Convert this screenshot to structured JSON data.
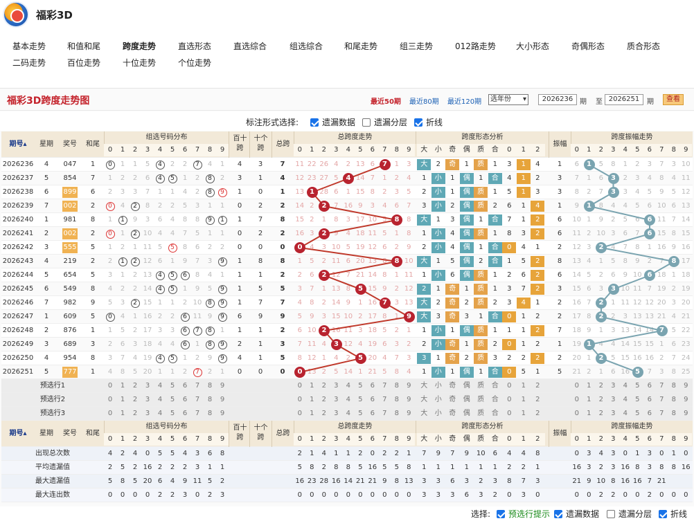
{
  "site": {
    "title": "福彩3D"
  },
  "nav": [
    "基本走势",
    "和值和尾",
    "跨度走势",
    "直选形态",
    "直选综合",
    "组选综合",
    "和尾走势",
    "组三走势",
    "012路走势",
    "大小形态",
    "奇偶形态",
    "质合形态",
    "二码走势",
    "百位走势",
    "十位走势",
    "个位走势"
  ],
  "nav_active": "跨度走势",
  "panel": {
    "title": "福彩3D跨度走势图",
    "links": [
      "最近50期",
      "最近80期",
      "最近120期"
    ],
    "active_link": "最近50期",
    "year_select": "选年份",
    "from": "2026236",
    "to": "2026251",
    "period": "期",
    "to_label": "至",
    "view": "查看"
  },
  "options": {
    "label": "标注形式选择:",
    "items": [
      {
        "label": "遗漏数据",
        "checked": true
      },
      {
        "label": "遗漏分层",
        "checked": false
      },
      {
        "label": "折线",
        "checked": true
      }
    ]
  },
  "headers": {
    "issue": "期号",
    "week": "星期",
    "number": "奖号",
    "tail": "和尾",
    "group_dist": "组选号码分布",
    "bt": "百十跨",
    "sg": "十个跨",
    "bg": "总跨",
    "span_trend": "总跨度走势",
    "shape": "跨度形态分析",
    "shape_cols": [
      "大",
      "小",
      "奇",
      "偶",
      "质",
      "合",
      "0",
      "1",
      "2"
    ],
    "amp": "振幅",
    "amp_trend": "跨度振幅走势",
    "digits": [
      "0",
      "1",
      "2",
      "3",
      "4",
      "5",
      "6",
      "7",
      "8",
      "9"
    ],
    "bt_short": "百十",
    "bt_short2": "跨",
    "sg_short": "十个",
    "sg_short2": "跨",
    "bg_short": "总跨"
  },
  "rows": [
    {
      "issue": "2026236",
      "week": "4",
      "num": "047",
      "tail": "1",
      "bt": "4",
      "sg": "3",
      "span": 7,
      "amp": "1",
      "dist": [
        "0",
        "1",
        "1",
        "5",
        "4",
        "2",
        "2",
        "7",
        "4",
        "1"
      ],
      "circ": [
        0,
        4,
        7
      ],
      "spanrow": [
        "11",
        "22",
        "26",
        "4",
        "2",
        "13",
        "6",
        "7",
        "1",
        "3"
      ],
      "shape": [
        "大",
        "2",
        "奇",
        "1",
        "质",
        "1",
        "3",
        "1",
        "4"
      ],
      "shapeOn": [
        0,
        2,
        4,
        7
      ],
      "amprow": [
        "6",
        "1",
        "5",
        "8",
        "1",
        "2",
        "3",
        "7",
        "3",
        "10"
      ],
      "ampval": 1
    },
    {
      "issue": "2026237",
      "week": "5",
      "num": "854",
      "tail": "7",
      "bt": "3",
      "sg": "1",
      "span": 4,
      "amp": "3",
      "dist": [
        "1",
        "2",
        "2",
        "6",
        "4",
        "5",
        "1",
        "2",
        "8",
        "2"
      ],
      "circ": [
        4,
        5,
        8
      ],
      "spanrow": [
        "12",
        "23",
        "27",
        "5",
        "4",
        "14",
        "7",
        "1",
        "2",
        "4"
      ],
      "shape": [
        "1",
        "小",
        "1",
        "偶",
        "1",
        "合",
        "4",
        "1",
        "2"
      ],
      "shapeOn": [
        1,
        3,
        5,
        7
      ],
      "amprow": [
        "7",
        "1",
        "6",
        "3",
        "2",
        "3",
        "4",
        "8",
        "4",
        "11"
      ],
      "ampval": 3
    },
    {
      "issue": "2026238",
      "week": "6",
      "num": "899",
      "tail": "6",
      "bt": "1",
      "sg": "0",
      "span": 1,
      "amp": "3",
      "dist": [
        "2",
        "3",
        "3",
        "7",
        "1",
        "1",
        "4",
        "2",
        "8",
        "9"
      ],
      "circ": [
        8,
        9
      ],
      "red": [
        9
      ],
      "spanrow": [
        "13",
        "1",
        "28",
        "6",
        "1",
        "15",
        "8",
        "2",
        "3",
        "5"
      ],
      "shape": [
        "2",
        "小",
        "1",
        "偶",
        "质",
        "1",
        "5",
        "1",
        "3"
      ],
      "shapeOn": [
        1,
        3,
        4,
        7
      ],
      "amprow": [
        "8",
        "2",
        "7",
        "3",
        "3",
        "4",
        "5",
        "9",
        "5",
        "12"
      ],
      "ampval": 3
    },
    {
      "issue": "2026239",
      "week": "7",
      "num": "002",
      "tail": "2",
      "bt": "0",
      "sg": "2",
      "span": 2,
      "amp": "1",
      "dist": [
        "0",
        "4",
        "2",
        "8",
        "2",
        "2",
        "5",
        "3",
        "1",
        "1"
      ],
      "circ": [
        0,
        2
      ],
      "red": [
        0
      ],
      "spanrow": [
        "14",
        "2",
        "2",
        "7",
        "16",
        "9",
        "3",
        "4",
        "6",
        "7"
      ],
      "shape": [
        "3",
        "小",
        "2",
        "偶",
        "质",
        "2",
        "6",
        "1",
        "4"
      ],
      "shapeOn": [
        1,
        3,
        4,
        8
      ],
      "amprow": [
        "9",
        "1",
        "8",
        "4",
        "4",
        "5",
        "6",
        "10",
        "6",
        "13"
      ],
      "ampval": 1
    },
    {
      "issue": "2026240",
      "week": "1",
      "num": "981",
      "tail": "8",
      "bt": "1",
      "sg": "7",
      "span": 8,
      "amp": "6",
      "dist": [
        "1",
        "1",
        "9",
        "3",
        "6",
        "4",
        "8",
        "8",
        "9",
        "1"
      ],
      "circ": [
        1,
        8,
        9
      ],
      "spanrow": [
        "15",
        "2",
        "1",
        "8",
        "3",
        "17",
        "10",
        "5",
        "8",
        "8"
      ],
      "shape": [
        "大",
        "1",
        "3",
        "偶",
        "1",
        "合",
        "7",
        "1",
        "2"
      ],
      "shapeOn": [
        0,
        3,
        5,
        8
      ],
      "amprow": [
        "10",
        "1",
        "9",
        "2",
        "5",
        "6",
        "6",
        "11",
        "7",
        "14"
      ],
      "ampval": 6
    },
    {
      "issue": "2026241",
      "week": "2",
      "num": "002",
      "tail": "2",
      "bt": "0",
      "sg": "2",
      "span": 2,
      "amp": "6",
      "dist": [
        "0",
        "1",
        "2",
        "10",
        "4",
        "4",
        "7",
        "5",
        "1",
        "1"
      ],
      "circ": [
        0,
        2
      ],
      "red": [
        0
      ],
      "spanrow": [
        "16",
        "3",
        "2",
        "9",
        "4",
        "18",
        "11",
        "5",
        "1",
        "8"
      ],
      "shape": [
        "1",
        "小",
        "4",
        "偶",
        "质",
        "1",
        "8",
        "3",
        "2"
      ],
      "shapeOn": [
        1,
        3,
        4,
        8
      ],
      "amprow": [
        "11",
        "2",
        "10",
        "3",
        "6",
        "7",
        "6",
        "15",
        "8",
        "15"
      ],
      "ampval": 6
    },
    {
      "issue": "2026242",
      "week": "3",
      "num": "555",
      "tail": "5",
      "bt": "0",
      "sg": "0",
      "span": 0,
      "amp": "2",
      "dist": [
        "1",
        "2",
        "1",
        "11",
        "5",
        "5",
        "8",
        "6",
        "2",
        "2"
      ],
      "circ": [
        5
      ],
      "red": [
        5
      ],
      "spanrow": [
        "0",
        "4",
        "3",
        "10",
        "5",
        "19",
        "12",
        "6",
        "2",
        "9"
      ],
      "shape": [
        "2",
        "小",
        "4",
        "偶",
        "1",
        "合",
        "0",
        "4",
        "1"
      ],
      "shapeOn": [
        1,
        3,
        5,
        6
      ],
      "amprow": [
        "12",
        "3",
        "2",
        "4",
        "7",
        "8",
        "1",
        "16",
        "9",
        "16"
      ],
      "ampval": 2
    },
    {
      "issue": "2026243",
      "week": "4",
      "num": "219",
      "tail": "2",
      "bt": "1",
      "sg": "8",
      "span": 8,
      "amp": "8",
      "dist": [
        "2",
        "1",
        "2",
        "12",
        "6",
        "1",
        "9",
        "7",
        "3",
        "9"
      ],
      "circ": [
        1,
        2,
        9
      ],
      "spanrow": [
        "1",
        "5",
        "2",
        "11",
        "6",
        "20",
        "13",
        "8",
        "8",
        "10"
      ],
      "shape": [
        "大",
        "1",
        "5",
        "偶",
        "2",
        "合",
        "1",
        "5",
        "2"
      ],
      "shapeOn": [
        0,
        3,
        5,
        8
      ],
      "amprow": [
        "13",
        "4",
        "1",
        "5",
        "8",
        "9",
        "2",
        "7",
        "8",
        "17"
      ],
      "ampval": 8
    },
    {
      "issue": "2026244",
      "week": "5",
      "num": "654",
      "tail": "5",
      "bt": "1",
      "sg": "1",
      "span": 2,
      "amp": "6",
      "dist": [
        "3",
        "1",
        "2",
        "13",
        "4",
        "5",
        "6",
        "8",
        "4",
        "1"
      ],
      "circ": [
        4,
        5,
        6
      ],
      "spanrow": [
        "2",
        "6",
        "2",
        "12",
        "7",
        "21",
        "14",
        "8",
        "1",
        "11"
      ],
      "shape": [
        "1",
        "小",
        "6",
        "偶",
        "质",
        "1",
        "2",
        "6",
        "2"
      ],
      "shapeOn": [
        1,
        3,
        4,
        8
      ],
      "amprow": [
        "14",
        "5",
        "2",
        "6",
        "9",
        "10",
        "6",
        "18",
        "1",
        "18"
      ],
      "ampval": 6
    },
    {
      "issue": "2026245",
      "week": "6",
      "num": "549",
      "tail": "8",
      "bt": "1",
      "sg": "5",
      "span": 5,
      "amp": "3",
      "dist": [
        "4",
        "2",
        "2",
        "14",
        "4",
        "5",
        "1",
        "9",
        "5",
        "9"
      ],
      "circ": [
        4,
        5,
        9
      ],
      "spanrow": [
        "3",
        "7",
        "1",
        "13",
        "8",
        "5",
        "15",
        "9",
        "2",
        "12"
      ],
      "shape": [
        "2",
        "1",
        "奇",
        "1",
        "质",
        "1",
        "3",
        "7",
        "2"
      ],
      "shapeOn": [
        0,
        2,
        4,
        8
      ],
      "amprow": [
        "15",
        "6",
        "3",
        "3",
        "10",
        "11",
        "7",
        "19",
        "2",
        "19"
      ],
      "ampval": 3
    },
    {
      "issue": "2026246",
      "week": "7",
      "num": "982",
      "tail": "9",
      "bt": "1",
      "sg": "7",
      "span": 7,
      "amp": "2",
      "dist": [
        "5",
        "3",
        "2",
        "15",
        "1",
        "1",
        "2",
        "10",
        "8",
        "9"
      ],
      "circ": [
        2,
        8,
        9
      ],
      "spanrow": [
        "4",
        "8",
        "2",
        "14",
        "9",
        "1",
        "16",
        "7",
        "3",
        "13"
      ],
      "shape": [
        "大",
        "2",
        "奇",
        "2",
        "质",
        "2",
        "3",
        "4",
        "1"
      ],
      "shapeOn": [
        0,
        2,
        4,
        7
      ],
      "amprow": [
        "16",
        "7",
        "2",
        "1",
        "11",
        "12",
        "12",
        "20",
        "3",
        "20"
      ],
      "ampval": 2
    },
    {
      "issue": "2026247",
      "week": "1",
      "num": "609",
      "tail": "5",
      "bt": "6",
      "sg": "9",
      "span": 9,
      "amp": "2",
      "dist": [
        "0",
        "4",
        "1",
        "16",
        "2",
        "2",
        "6",
        "11",
        "9",
        "9"
      ],
      "circ": [
        0,
        6,
        9
      ],
      "spanrow": [
        "5",
        "9",
        "3",
        "15",
        "10",
        "2",
        "17",
        "8",
        "1",
        "9"
      ],
      "shape": [
        "大",
        "3",
        "奇",
        "3",
        "1",
        "合",
        "0",
        "1",
        "2"
      ],
      "shapeOn": [
        0,
        2,
        5,
        6
      ],
      "amprow": [
        "17",
        "8",
        "2",
        "2",
        "3",
        "13",
        "13",
        "21",
        "4",
        "21"
      ],
      "ampval": 2
    },
    {
      "issue": "2026248",
      "week": "2",
      "num": "876",
      "tail": "1",
      "bt": "1",
      "sg": "1",
      "span": 2,
      "amp": "7",
      "dist": [
        "1",
        "5",
        "2",
        "17",
        "3",
        "3",
        "6",
        "7",
        "8",
        "1"
      ],
      "circ": [
        6,
        7,
        8
      ],
      "spanrow": [
        "6",
        "10",
        "2",
        "16",
        "11",
        "3",
        "18",
        "5",
        "2",
        "1"
      ],
      "shape": [
        "1",
        "小",
        "1",
        "偶",
        "质",
        "1",
        "1",
        "1",
        "2"
      ],
      "shapeOn": [
        1,
        3,
        4,
        8
      ],
      "amprow": [
        "18",
        "9",
        "1",
        "3",
        "13",
        "14",
        "14",
        "7",
        "5",
        "22"
      ],
      "ampval": 7
    },
    {
      "issue": "2026249",
      "week": "3",
      "num": "689",
      "tail": "3",
      "bt": "2",
      "sg": "1",
      "span": 3,
      "amp": "1",
      "dist": [
        "2",
        "6",
        "3",
        "18",
        "4",
        "4",
        "6",
        "1",
        "8",
        "9"
      ],
      "circ": [
        6,
        8,
        9
      ],
      "spanrow": [
        "7",
        "11",
        "4",
        "3",
        "12",
        "4",
        "19",
        "6",
        "3",
        "2"
      ],
      "shape": [
        "2",
        "小",
        "奇",
        "1",
        "质",
        "2",
        "0",
        "1",
        "2"
      ],
      "shapeOn": [
        1,
        2,
        4,
        6
      ],
      "amprow": [
        "19",
        "1",
        "4",
        "4",
        "14",
        "15",
        "15",
        "1",
        "6",
        "23"
      ],
      "ampval": 1
    },
    {
      "issue": "2026250",
      "week": "4",
      "num": "954",
      "tail": "8",
      "bt": "4",
      "sg": "1",
      "span": 5,
      "amp": "2",
      "dist": [
        "3",
        "7",
        "4",
        "19",
        "4",
        "5",
        "1",
        "2",
        "9",
        "9"
      ],
      "circ": [
        4,
        5,
        9
      ],
      "spanrow": [
        "8",
        "12",
        "1",
        "4",
        "2",
        "5",
        "20",
        "4",
        "7",
        "3"
      ],
      "shape": [
        "3",
        "1",
        "奇",
        "2",
        "质",
        "3",
        "2",
        "2",
        "2"
      ],
      "shapeOn": [
        0,
        2,
        4,
        8
      ],
      "amprow": [
        "20",
        "1",
        "2",
        "5",
        "15",
        "16",
        "16",
        "2",
        "7",
        "24"
      ],
      "ampval": 2
    },
    {
      "issue": "2026251",
      "week": "5",
      "num": "777",
      "tail": "1",
      "bt": "0",
      "sg": "0",
      "span": 0,
      "amp": "5",
      "dist": [
        "4",
        "8",
        "5",
        "20",
        "1",
        "1",
        "2",
        "7",
        "2",
        "1"
      ],
      "circ": [
        7
      ],
      "red": [
        7
      ],
      "spanrow": [
        "0",
        "13",
        "2",
        "5",
        "14",
        "1",
        "21",
        "5",
        "8",
        "4"
      ],
      "shape": [
        "1",
        "小",
        "1",
        "偶",
        "1",
        "合",
        "0",
        "5",
        "1"
      ],
      "shapeOn": [
        1,
        3,
        5,
        6
      ],
      "amprow": [
        "21",
        "2",
        "1",
        "6",
        "16",
        "5",
        "7",
        "3",
        "8",
        "25"
      ],
      "ampval": 5
    }
  ],
  "predict": {
    "labels": [
      "预选行1",
      "预选行2",
      "预选行3"
    ]
  },
  "stats": [
    {
      "label": "出现总次数",
      "dist": [
        "4",
        "2",
        "4",
        "0",
        "5",
        "5",
        "4",
        "3",
        "6",
        "8"
      ],
      "span": [
        "2",
        "1",
        "4",
        "1",
        "1",
        "2",
        "0",
        "2",
        "2",
        "1"
      ],
      "shape": [
        "7",
        "9",
        "7",
        "9",
        "10",
        "6",
        "4",
        "4",
        "8"
      ],
      "amp": [
        "0",
        "3",
        "4",
        "3",
        "0",
        "1",
        "3",
        "0",
        "1",
        "0"
      ]
    },
    {
      "label": "平均遗漏值",
      "dist": [
        "2",
        "5",
        "2",
        "16",
        "2",
        "2",
        "2",
        "3",
        "1",
        "1"
      ],
      "span": [
        "5",
        "8",
        "2",
        "8",
        "8",
        "5",
        "16",
        "5",
        "5",
        "8"
      ],
      "shape": [
        "1",
        "1",
        "1",
        "1",
        "1",
        "1",
        "2",
        "2",
        "1"
      ],
      "amp": [
        "16",
        "3",
        "2",
        "3",
        "16",
        "8",
        "3",
        "8",
        "8",
        "16"
      ]
    },
    {
      "label": "最大遗漏值",
      "dist": [
        "5",
        "8",
        "5",
        "20",
        "6",
        "4",
        "9",
        "11",
        "5",
        "2"
      ],
      "span": [
        "16",
        "23",
        "28",
        "16",
        "14",
        "21",
        "21",
        "9",
        "8",
        "13"
      ],
      "shape": [
        "3",
        "3",
        "6",
        "3",
        "2",
        "3",
        "8",
        "7",
        "3"
      ],
      "amp": [
        "21",
        "9",
        "10",
        "8",
        "16",
        "16",
        "7",
        "21",
        "",
        ""
      ]
    },
    {
      "label": "最大连出数",
      "dist": [
        "0",
        "0",
        "0",
        "0",
        "2",
        "2",
        "3",
        "0",
        "2",
        "3"
      ],
      "span": [
        "0",
        "0",
        "0",
        "0",
        "0",
        "0",
        "0",
        "0",
        "0",
        "0"
      ],
      "shape": [
        "3",
        "3",
        "3",
        "6",
        "3",
        "2",
        "0",
        "3",
        "0"
      ],
      "amp": [
        "0",
        "0",
        "2",
        "2",
        "0",
        "0",
        "2",
        "0",
        "0",
        "0"
      ]
    }
  ],
  "footer": {
    "label": "选择:",
    "items": [
      {
        "label": "预选行提示",
        "checked": true,
        "color": "#1a8a1a"
      },
      {
        "label": "遗漏数据",
        "checked": true
      },
      {
        "label": "遗漏分层",
        "checked": false
      },
      {
        "label": "折线",
        "checked": true
      }
    ]
  },
  "colors": {
    "ball_red": "#b8232f",
    "ball_teal": "#7aa4b0",
    "line_red": "#c0392b",
    "line_teal": "#7aa4b0",
    "box_teal": "#5fa8b5",
    "box_gold": "#e4a24a",
    "box_orange": "#e7a43a",
    "num_hl": "#f0b252"
  }
}
